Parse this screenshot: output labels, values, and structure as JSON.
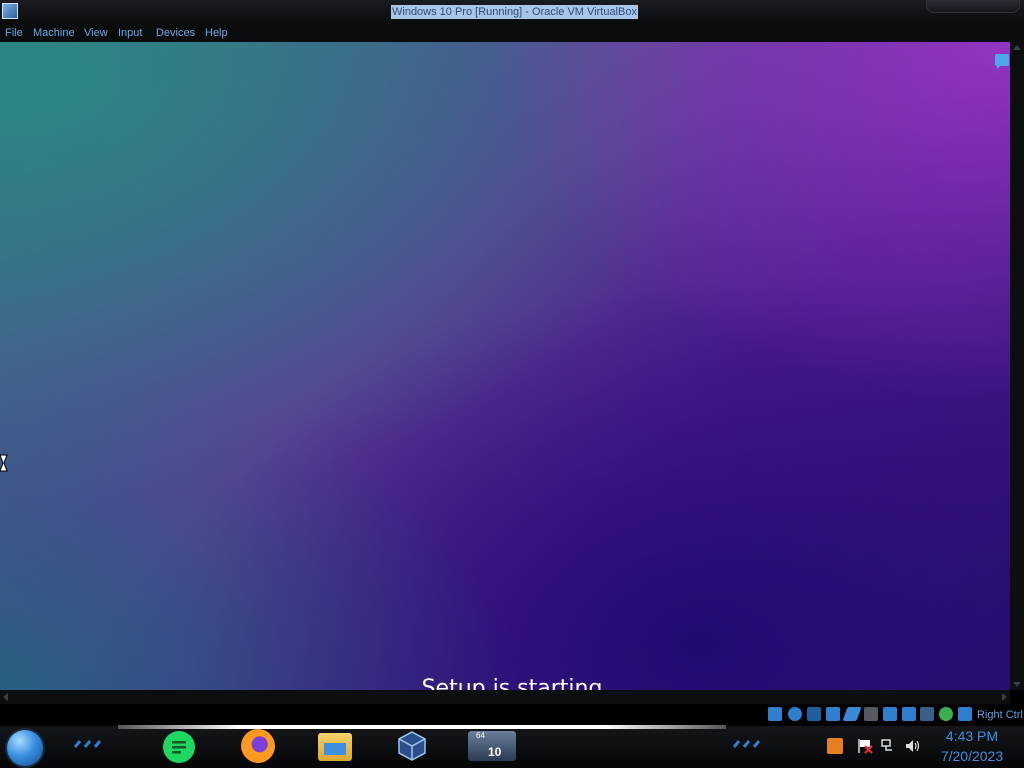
{
  "window": {
    "title": "Windows 10 Pro [Running] - Oracle VM VirtualBox"
  },
  "menu": {
    "items": [
      "File",
      "Machine",
      "View",
      "Input",
      "Devices",
      "Help"
    ]
  },
  "vm": {
    "status_text": "Setup is starting",
    "colors": {
      "teal": "#2a8a86",
      "purple": "#8a3ab8",
      "deep_indigo": "#24106e"
    }
  },
  "statusbar": {
    "icons": [
      "hard-disk-icon",
      "optical-drive-icon",
      "audio-icon",
      "network-icon",
      "usb-icon",
      "shared-folders-icon",
      "display-icon",
      "recording-icon",
      "vt-x-icon",
      "mouse-integration-icon",
      "keyboard-capture-icon"
    ],
    "host_key": "Right Ctrl"
  },
  "taskbar": {
    "apps": [
      "spotify-icon",
      "firefox-icon",
      "file-explorer-icon",
      "virtualbox-icon",
      "virtualbox-vm-icon"
    ],
    "vm_badge_top": "64",
    "vm_badge_bottom": "10",
    "clock_time": "4:43 PM",
    "clock_date": "7/20/2023"
  }
}
